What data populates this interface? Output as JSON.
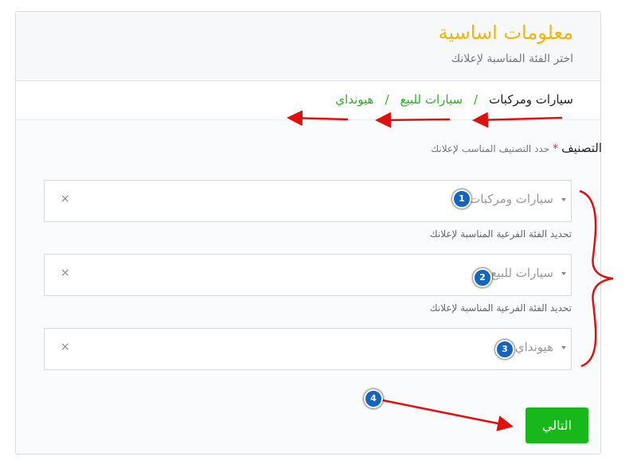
{
  "header": {
    "title": "معلومات اساسية",
    "subtitle": "اختر الفئة المناسبة لإعلانك"
  },
  "breadcrumb": {
    "items": [
      "سيارات ومركبات",
      "سيارات للبيع",
      "هيونداي"
    ],
    "separator": "/"
  },
  "form": {
    "category_label": "التصنيف",
    "required_mark": "*",
    "category_hint": "حدد التصنيف المناسب لإعلانك",
    "selects": [
      {
        "value": "سيارات ومركبات",
        "clear": "×"
      },
      {
        "value": "سيارات للبيع",
        "clear": "×"
      },
      {
        "value": "هيونداي",
        "clear": "×"
      }
    ],
    "subcategory_help": "تحديد الفئة الفرعية المناسبة لإعلانك"
  },
  "annotations": {
    "badges": [
      "1",
      "2",
      "3",
      "4"
    ],
    "badge_color": "#1565c0",
    "arrow_color": "#e01010"
  },
  "actions": {
    "next_label": "التالي"
  },
  "colors": {
    "title": "#f2b40c",
    "link": "#25b31a",
    "primary_button": "#18b81a"
  }
}
